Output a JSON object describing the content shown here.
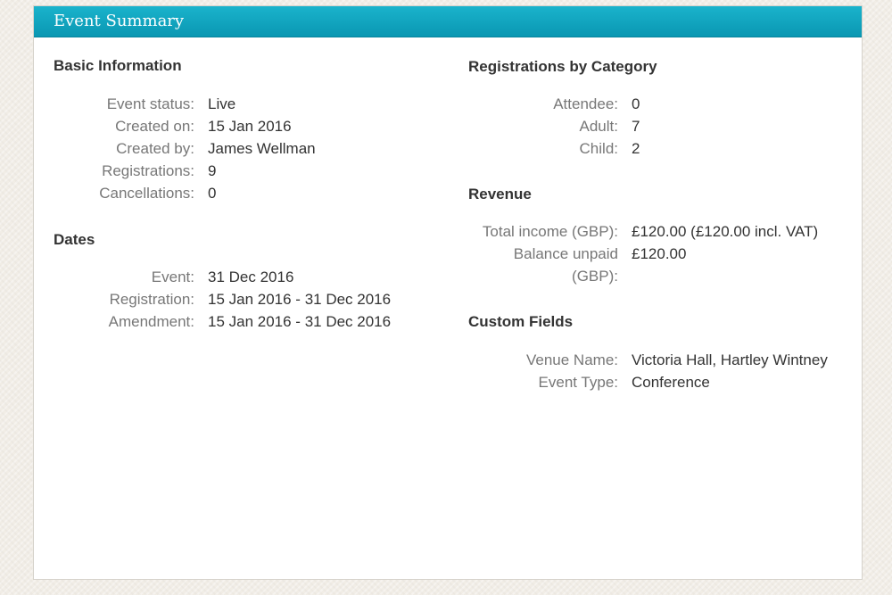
{
  "panel": {
    "title": "Event Summary"
  },
  "basic_info": {
    "title": "Basic Information",
    "rows": [
      {
        "label": "Event status:",
        "value": "Live"
      },
      {
        "label": "Created on:",
        "value": "15 Jan 2016"
      },
      {
        "label": "Created by:",
        "value": "James Wellman"
      },
      {
        "label": "Registrations:",
        "value": "9"
      },
      {
        "label": "Cancellations:",
        "value": "0"
      }
    ]
  },
  "dates": {
    "title": "Dates",
    "rows": [
      {
        "label": "Event:",
        "value": "31 Dec 2016"
      },
      {
        "label": "Registration:",
        "value": "15 Jan 2016 - 31 Dec 2016"
      },
      {
        "label": "Amendment:",
        "value": "15 Jan 2016 - 31 Dec 2016"
      }
    ]
  },
  "registrations_by_category": {
    "title": "Registrations by Category",
    "rows": [
      {
        "label": "Attendee:",
        "value": "0"
      },
      {
        "label": "Adult:",
        "value": "7"
      },
      {
        "label": "Child:",
        "value": "2"
      }
    ]
  },
  "revenue": {
    "title": "Revenue",
    "rows": [
      {
        "label": "Total income (GBP):",
        "value": "£120.00 (£120.00 incl. VAT)"
      },
      {
        "label": "Balance unpaid (GBP):",
        "value": "£120.00"
      }
    ]
  },
  "custom_fields": {
    "title": "Custom Fields",
    "rows": [
      {
        "label": "Venue Name:",
        "value": "Victoria Hall, Hartley Wintney"
      },
      {
        "label": "Event Type:",
        "value": "Conference"
      }
    ]
  }
}
